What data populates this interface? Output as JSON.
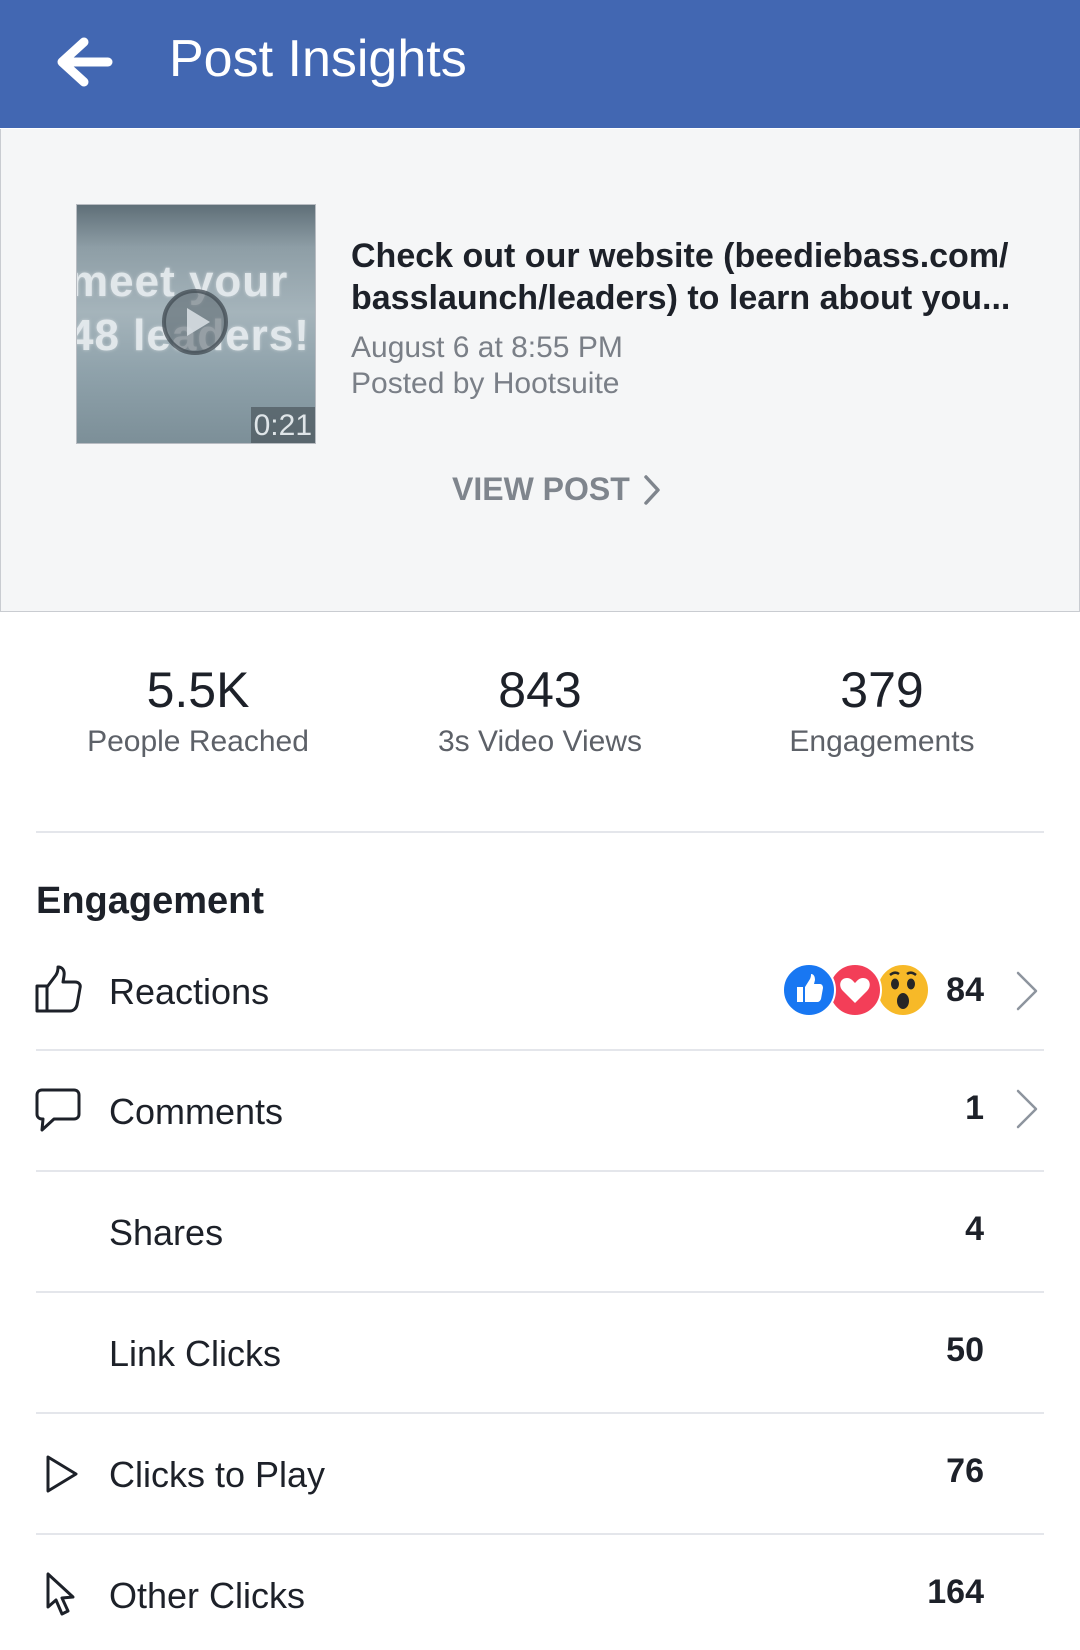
{
  "app_bar": {
    "title": "Post Insights",
    "back_icon": "arrow-left-icon",
    "background": "#4267b2"
  },
  "post": {
    "thumbnail": {
      "overlay_line1": "meet your",
      "overlay_line2": "48 leaders!",
      "duration": "0:21"
    },
    "text": "Check out our website (beediebass.com/ basslaunch/leaders) to learn about you...",
    "date": "August 6 at 8:55 PM",
    "posted_by": "Posted by Hootsuite",
    "view_post_label": "VIEW POST"
  },
  "stats": [
    {
      "value": "5.5K",
      "label": "People Reached"
    },
    {
      "value": "843",
      "label": "3s Video Views"
    },
    {
      "value": "379",
      "label": "Engagements"
    }
  ],
  "engagement": {
    "title": "Engagement",
    "rows": [
      {
        "label": "Reactions",
        "value": "84",
        "icon": "thumbs-up-icon"
      },
      {
        "label": "Comments",
        "value": "1",
        "icon": "comment-icon"
      },
      {
        "label": "Shares",
        "value": "4"
      },
      {
        "label": "Link Clicks",
        "value": "50"
      },
      {
        "label": "Clicks to Play",
        "value": "76",
        "icon": "play-outline-icon"
      },
      {
        "label": "Other Clicks",
        "value": "164",
        "icon": "cursor-icon"
      }
    ],
    "reaction_icons": [
      "like-reaction-icon",
      "love-reaction-icon",
      "wow-reaction-icon"
    ],
    "colors": {
      "like": "#1877f2",
      "love": "#f33e58",
      "wow": "#f7b928"
    }
  }
}
